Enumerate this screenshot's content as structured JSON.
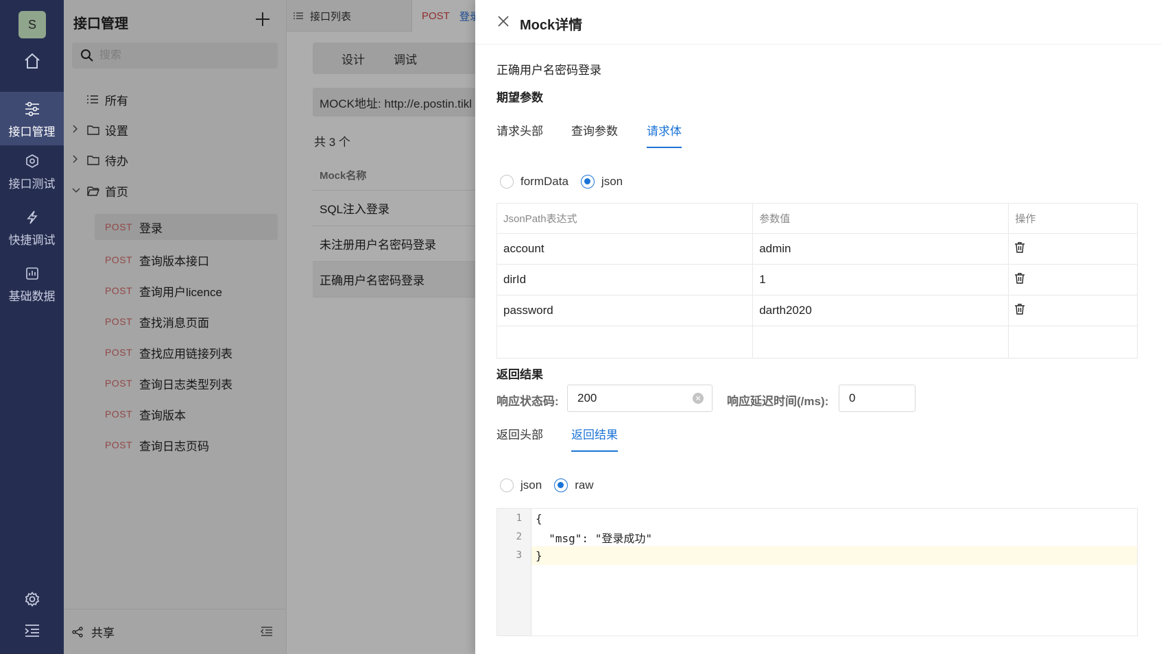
{
  "rail": {
    "avatar": "S",
    "items": [
      {
        "label": "",
        "icon": "home-icon"
      },
      {
        "label": "接口管理",
        "icon": "sliders-icon"
      },
      {
        "label": "接口测试",
        "icon": "cube-icon"
      },
      {
        "label": "快捷调试",
        "icon": "lightning-icon"
      },
      {
        "label": "基础数据",
        "icon": "chart-icon"
      }
    ]
  },
  "sidebar": {
    "title": "接口管理",
    "search_placeholder": "搜索",
    "all_label": "所有",
    "folders": [
      "设置",
      "待办",
      "首页"
    ],
    "apis": [
      {
        "method": "POST",
        "name": "登录"
      },
      {
        "method": "POST",
        "name": "查询版本接口"
      },
      {
        "method": "POST",
        "name": "查询用户licence"
      },
      {
        "method": "POST",
        "name": "查找消息页面"
      },
      {
        "method": "POST",
        "name": "查找应用链接列表"
      },
      {
        "method": "POST",
        "name": "查询日志类型列表"
      },
      {
        "method": "POST",
        "name": "查询版本"
      },
      {
        "method": "POST",
        "name": "查询日志页码"
      }
    ],
    "share_label": "共享"
  },
  "main": {
    "tab1_label": "接口列表",
    "tab2_method": "POST",
    "tab2_name": "登录",
    "subtab_design": "设计",
    "subtab_debug": "调试",
    "mock_address": "MOCK地址: http://e.postin.tikl",
    "count_label": "共 3 个",
    "table_header": "Mock名称",
    "rows": [
      "SQL注入登录",
      "未注册用户名密码登录",
      "正确用户名密码登录"
    ]
  },
  "drawer": {
    "title": "Mock详情",
    "mock_name": "正确用户名密码登录",
    "expect_section": "期望参数",
    "tabs": [
      "请求头部",
      "查询参数",
      "请求体"
    ],
    "body_type_options": [
      "formData",
      "json"
    ],
    "params_table": {
      "headers": [
        "JsonPath表达式",
        "参数值",
        "操作"
      ],
      "rows": [
        {
          "path": "account",
          "value": "admin"
        },
        {
          "path": "dirId",
          "value": "1"
        },
        {
          "path": "password",
          "value": "darth2020"
        }
      ]
    },
    "result_section": "返回结果",
    "status_label": "响应状态码:",
    "status_value": "200",
    "delay_label": "响应延迟时间(/ms):",
    "delay_value": "0",
    "result_tabs": [
      "返回头部",
      "返回结果"
    ],
    "result_type_options": [
      "json",
      "raw"
    ],
    "code_lines": [
      "{",
      "  \"msg\": \"登录成功\"",
      "}"
    ],
    "line_numbers": [
      "1",
      "2",
      "3"
    ]
  },
  "colors": {
    "rail_bg": "#252e50",
    "accent": "#1a73d6",
    "method_post": "#d86a6a"
  }
}
